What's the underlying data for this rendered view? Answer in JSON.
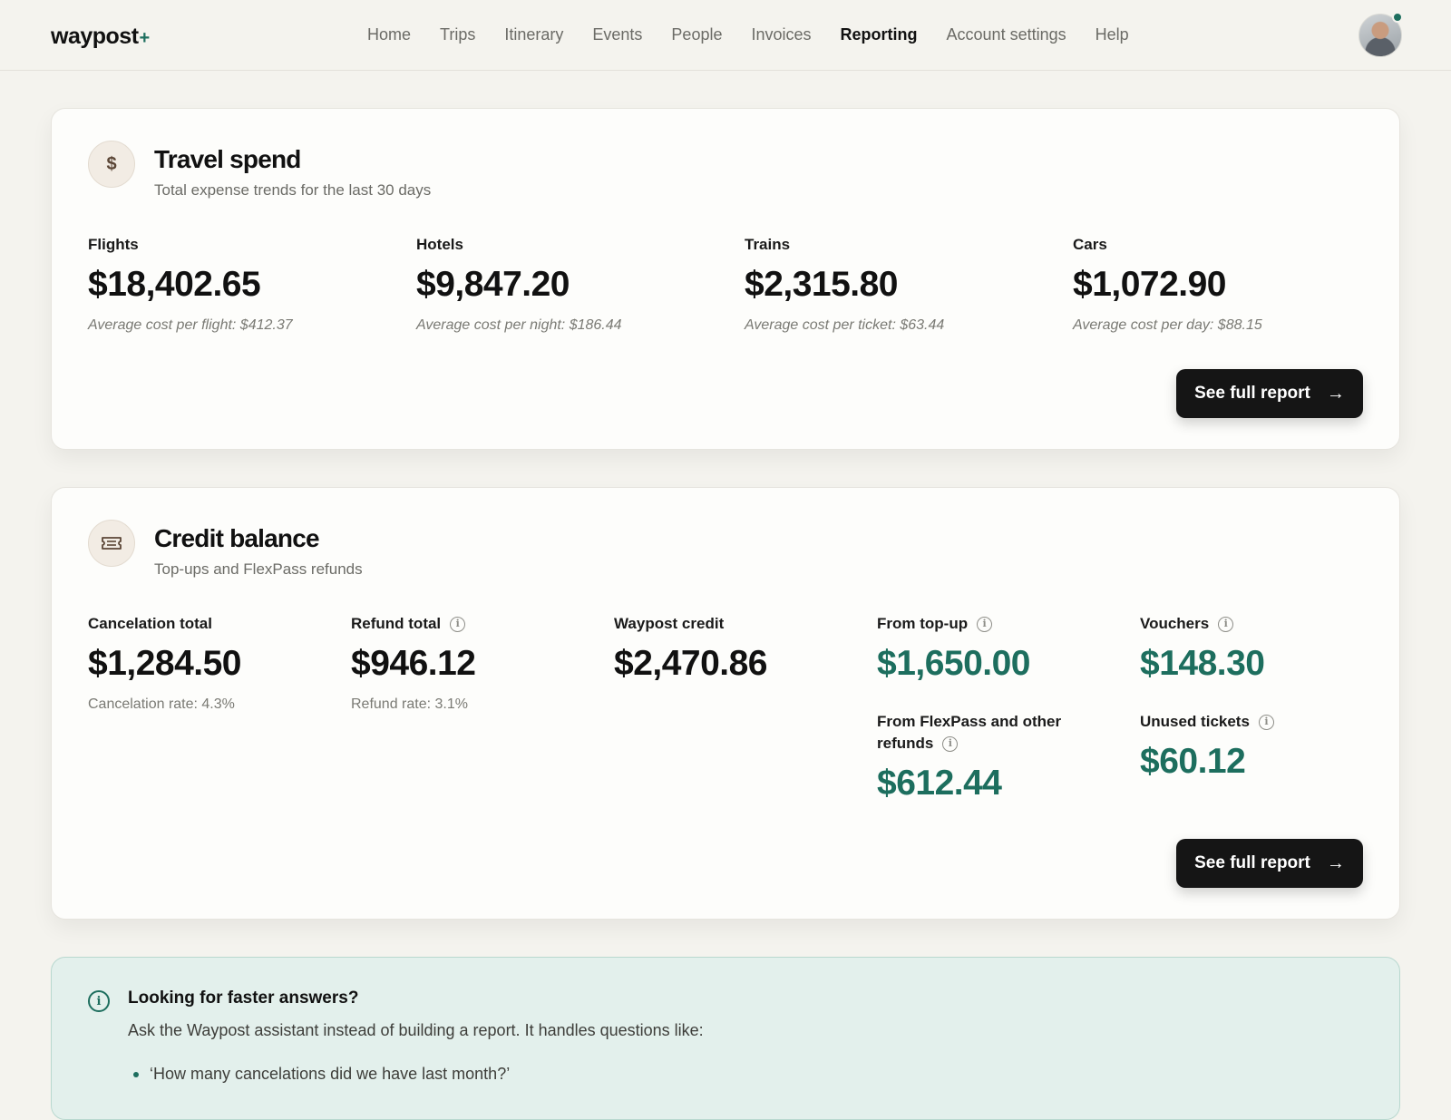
{
  "header": {
    "logo": "waypost",
    "logo_plus": "+",
    "nav": [
      "Home",
      "Trips",
      "Itinerary",
      "Events",
      "People",
      "Invoices",
      "Reporting",
      "Account settings",
      "Help"
    ],
    "active_nav": "Reporting"
  },
  "travel_spend": {
    "icon": "dollar-icon",
    "icon_glyph": "$",
    "title": "Travel spend",
    "subtitle": "Total expense trends for the last 30 days",
    "metrics": [
      {
        "label": "Flights",
        "value": "$18,402.65",
        "note": "Average cost per flight: $412.37"
      },
      {
        "label": "Hotels",
        "value": "$9,847.20",
        "note": "Average cost per night: $186.44"
      },
      {
        "label": "Trains",
        "value": "$2,315.80",
        "note": "Average cost per ticket: $63.44"
      },
      {
        "label": "Cars",
        "value": "$1,072.90",
        "note": "Average cost per day: $88.15"
      }
    ],
    "button": "See full report"
  },
  "credit_balance": {
    "icon": "ticket-icon",
    "title": "Credit balance",
    "subtitle": "Top-ups and FlexPass refunds",
    "cancelation": {
      "label": "Cancelation total",
      "value": "$1,284.50",
      "note": "Cancelation rate: 4.3%"
    },
    "refund": {
      "label": "Refund total",
      "value": "$946.12",
      "note": "Refund rate: 3.1%"
    },
    "credit": {
      "label": "Waypost credit",
      "value": "$2,470.86"
    },
    "topup": {
      "label": "From top-up",
      "value": "$1,650.00"
    },
    "vouchers": {
      "label": "Vouchers",
      "value": "$148.30"
    },
    "flexpass": {
      "label_line1": "From FlexPass and other",
      "label_line2": "refunds",
      "value": "$612.44"
    },
    "unused": {
      "label": "Unused tickets",
      "value": "$60.12"
    },
    "button": "See full report"
  },
  "banner": {
    "title": "Looking for faster answers?",
    "text": "Ask the Waypost assistant instead of building a report. It handles questions like:",
    "items": [
      "‘How many cancelations did we have last month?’"
    ]
  },
  "colors": {
    "accent_green": "#1d6e5e",
    "background": "#f4f3ee",
    "button": "#151515"
  }
}
